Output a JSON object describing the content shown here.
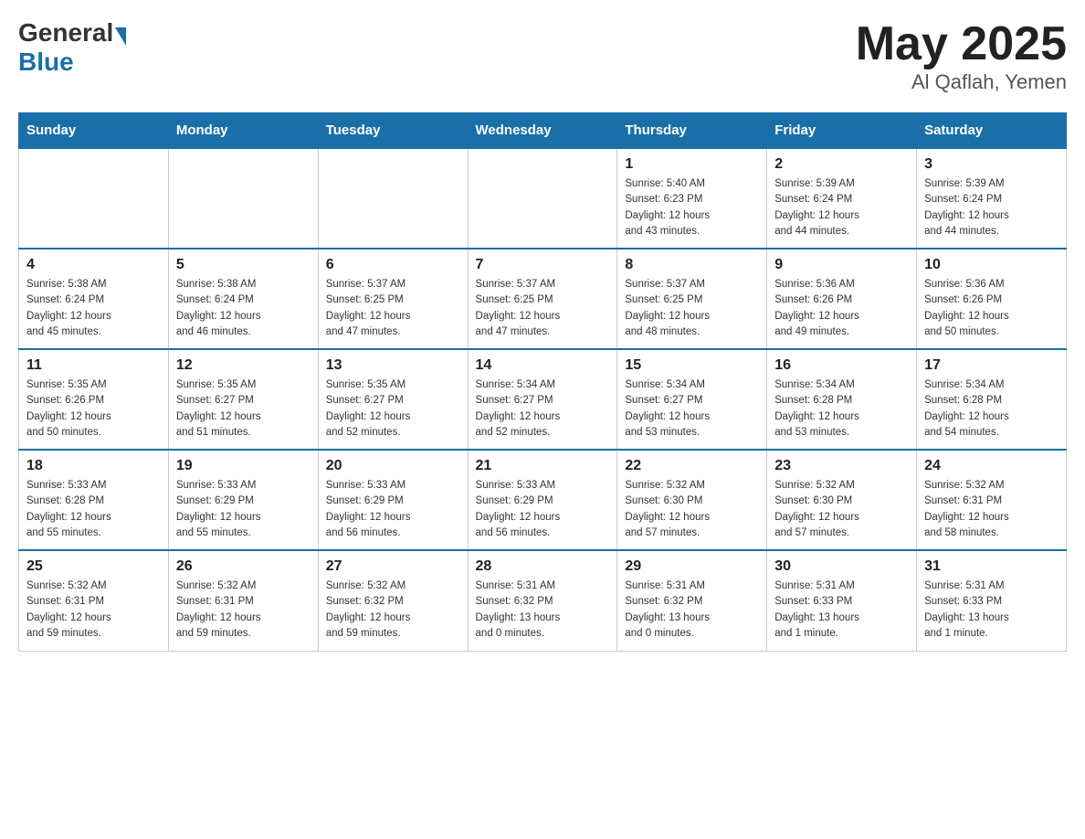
{
  "header": {
    "logo_general": "General",
    "logo_blue": "Blue",
    "title": "May 2025",
    "subtitle": "Al Qaflah, Yemen"
  },
  "weekdays": [
    "Sunday",
    "Monday",
    "Tuesday",
    "Wednesday",
    "Thursday",
    "Friday",
    "Saturday"
  ],
  "weeks": [
    [
      {
        "day": "",
        "info": ""
      },
      {
        "day": "",
        "info": ""
      },
      {
        "day": "",
        "info": ""
      },
      {
        "day": "",
        "info": ""
      },
      {
        "day": "1",
        "info": "Sunrise: 5:40 AM\nSunset: 6:23 PM\nDaylight: 12 hours\nand 43 minutes."
      },
      {
        "day": "2",
        "info": "Sunrise: 5:39 AM\nSunset: 6:24 PM\nDaylight: 12 hours\nand 44 minutes."
      },
      {
        "day": "3",
        "info": "Sunrise: 5:39 AM\nSunset: 6:24 PM\nDaylight: 12 hours\nand 44 minutes."
      }
    ],
    [
      {
        "day": "4",
        "info": "Sunrise: 5:38 AM\nSunset: 6:24 PM\nDaylight: 12 hours\nand 45 minutes."
      },
      {
        "day": "5",
        "info": "Sunrise: 5:38 AM\nSunset: 6:24 PM\nDaylight: 12 hours\nand 46 minutes."
      },
      {
        "day": "6",
        "info": "Sunrise: 5:37 AM\nSunset: 6:25 PM\nDaylight: 12 hours\nand 47 minutes."
      },
      {
        "day": "7",
        "info": "Sunrise: 5:37 AM\nSunset: 6:25 PM\nDaylight: 12 hours\nand 47 minutes."
      },
      {
        "day": "8",
        "info": "Sunrise: 5:37 AM\nSunset: 6:25 PM\nDaylight: 12 hours\nand 48 minutes."
      },
      {
        "day": "9",
        "info": "Sunrise: 5:36 AM\nSunset: 6:26 PM\nDaylight: 12 hours\nand 49 minutes."
      },
      {
        "day": "10",
        "info": "Sunrise: 5:36 AM\nSunset: 6:26 PM\nDaylight: 12 hours\nand 50 minutes."
      }
    ],
    [
      {
        "day": "11",
        "info": "Sunrise: 5:35 AM\nSunset: 6:26 PM\nDaylight: 12 hours\nand 50 minutes."
      },
      {
        "day": "12",
        "info": "Sunrise: 5:35 AM\nSunset: 6:27 PM\nDaylight: 12 hours\nand 51 minutes."
      },
      {
        "day": "13",
        "info": "Sunrise: 5:35 AM\nSunset: 6:27 PM\nDaylight: 12 hours\nand 52 minutes."
      },
      {
        "day": "14",
        "info": "Sunrise: 5:34 AM\nSunset: 6:27 PM\nDaylight: 12 hours\nand 52 minutes."
      },
      {
        "day": "15",
        "info": "Sunrise: 5:34 AM\nSunset: 6:27 PM\nDaylight: 12 hours\nand 53 minutes."
      },
      {
        "day": "16",
        "info": "Sunrise: 5:34 AM\nSunset: 6:28 PM\nDaylight: 12 hours\nand 53 minutes."
      },
      {
        "day": "17",
        "info": "Sunrise: 5:34 AM\nSunset: 6:28 PM\nDaylight: 12 hours\nand 54 minutes."
      }
    ],
    [
      {
        "day": "18",
        "info": "Sunrise: 5:33 AM\nSunset: 6:28 PM\nDaylight: 12 hours\nand 55 minutes."
      },
      {
        "day": "19",
        "info": "Sunrise: 5:33 AM\nSunset: 6:29 PM\nDaylight: 12 hours\nand 55 minutes."
      },
      {
        "day": "20",
        "info": "Sunrise: 5:33 AM\nSunset: 6:29 PM\nDaylight: 12 hours\nand 56 minutes."
      },
      {
        "day": "21",
        "info": "Sunrise: 5:33 AM\nSunset: 6:29 PM\nDaylight: 12 hours\nand 56 minutes."
      },
      {
        "day": "22",
        "info": "Sunrise: 5:32 AM\nSunset: 6:30 PM\nDaylight: 12 hours\nand 57 minutes."
      },
      {
        "day": "23",
        "info": "Sunrise: 5:32 AM\nSunset: 6:30 PM\nDaylight: 12 hours\nand 57 minutes."
      },
      {
        "day": "24",
        "info": "Sunrise: 5:32 AM\nSunset: 6:31 PM\nDaylight: 12 hours\nand 58 minutes."
      }
    ],
    [
      {
        "day": "25",
        "info": "Sunrise: 5:32 AM\nSunset: 6:31 PM\nDaylight: 12 hours\nand 59 minutes."
      },
      {
        "day": "26",
        "info": "Sunrise: 5:32 AM\nSunset: 6:31 PM\nDaylight: 12 hours\nand 59 minutes."
      },
      {
        "day": "27",
        "info": "Sunrise: 5:32 AM\nSunset: 6:32 PM\nDaylight: 12 hours\nand 59 minutes."
      },
      {
        "day": "28",
        "info": "Sunrise: 5:31 AM\nSunset: 6:32 PM\nDaylight: 13 hours\nand 0 minutes."
      },
      {
        "day": "29",
        "info": "Sunrise: 5:31 AM\nSunset: 6:32 PM\nDaylight: 13 hours\nand 0 minutes."
      },
      {
        "day": "30",
        "info": "Sunrise: 5:31 AM\nSunset: 6:33 PM\nDaylight: 13 hours\nand 1 minute."
      },
      {
        "day": "31",
        "info": "Sunrise: 5:31 AM\nSunset: 6:33 PM\nDaylight: 13 hours\nand 1 minute."
      }
    ]
  ]
}
